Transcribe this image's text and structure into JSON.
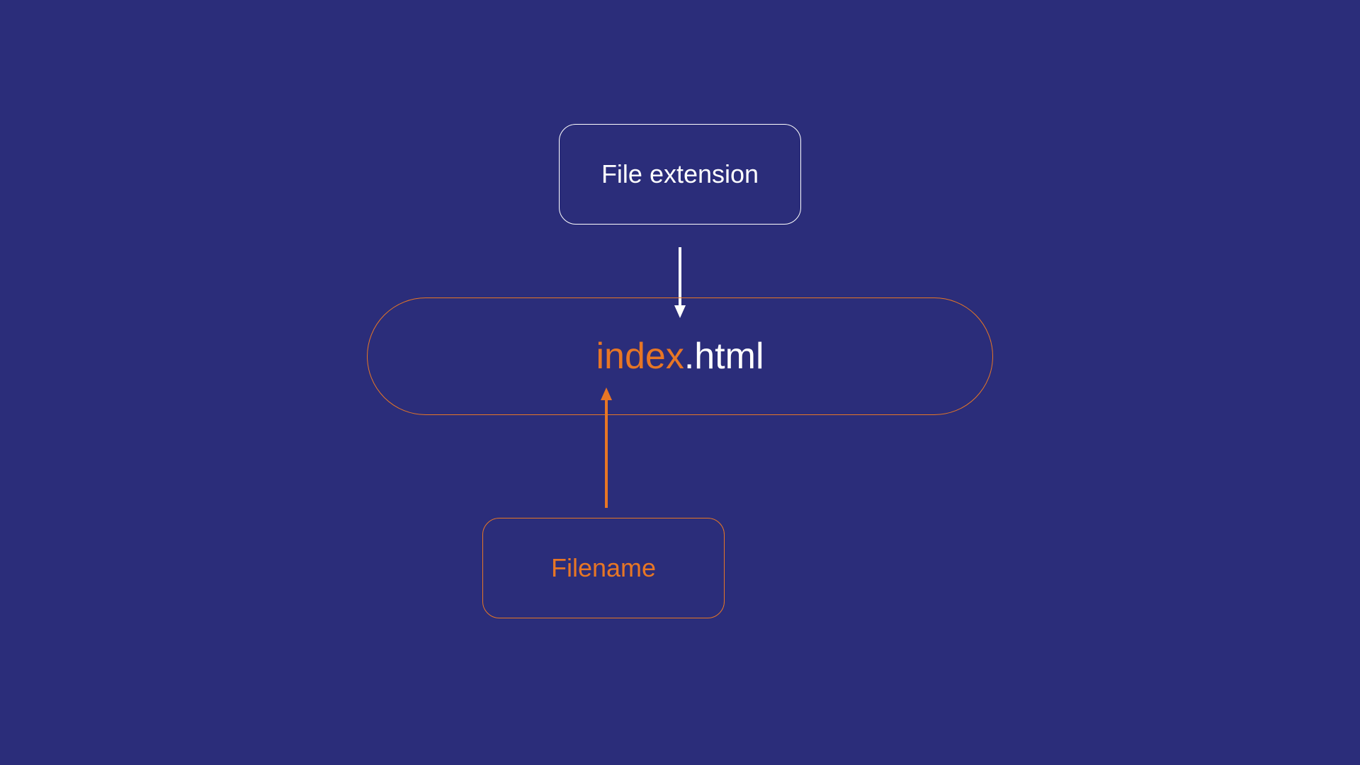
{
  "diagram": {
    "top_label": "File extension",
    "bottom_label": "Filename",
    "filename_text": "index",
    "extension_text": ".html"
  },
  "colors": {
    "background": "#2b2d7a",
    "orange": "#e77625",
    "white": "#ffffff"
  }
}
